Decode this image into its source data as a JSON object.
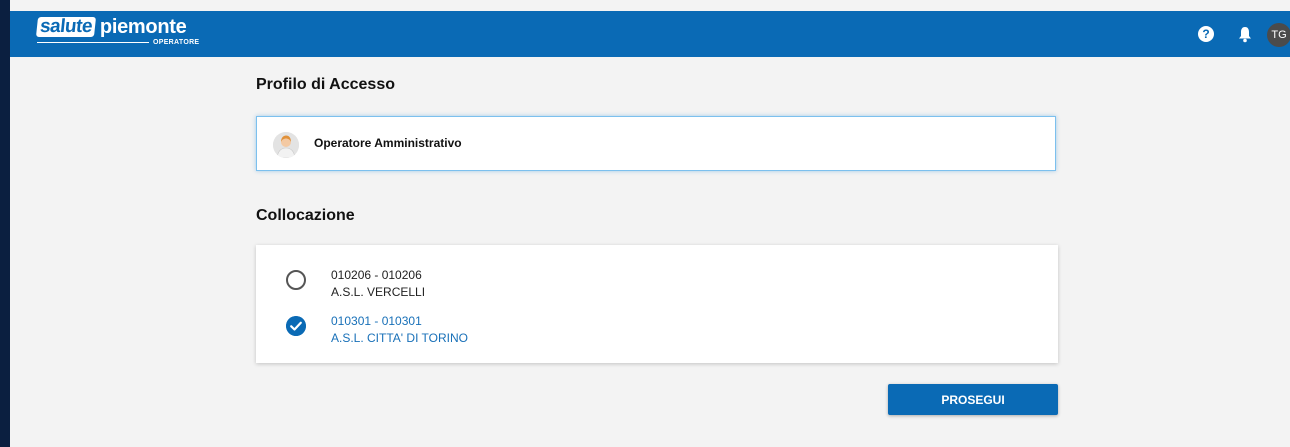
{
  "header": {
    "logo_box": "salute",
    "logo_text": "piemonte",
    "logo_sub": "OPERATORE",
    "help_icon_glyph": "?",
    "avatar_initials": "TG",
    "bg_color": "#0a6ab5"
  },
  "profile": {
    "title": "Profilo di Accesso",
    "selected_label": "Operatore Amministrativo",
    "icon": "person-avatar-icon"
  },
  "collocazione": {
    "title": "Collocazione",
    "options": [
      {
        "code": "010206 - 010206",
        "name": "A.S.L. VERCELLI",
        "selected": false
      },
      {
        "code": "010301 - 010301",
        "name": "A.S.L. CITTA' DI TORINO",
        "selected": true
      }
    ]
  },
  "actions": {
    "continue_label": "PROSEGUI"
  },
  "colors": {
    "accent": "#0a6ab5",
    "selected_text": "#1870b8",
    "left_bar": "#0b1f40"
  }
}
